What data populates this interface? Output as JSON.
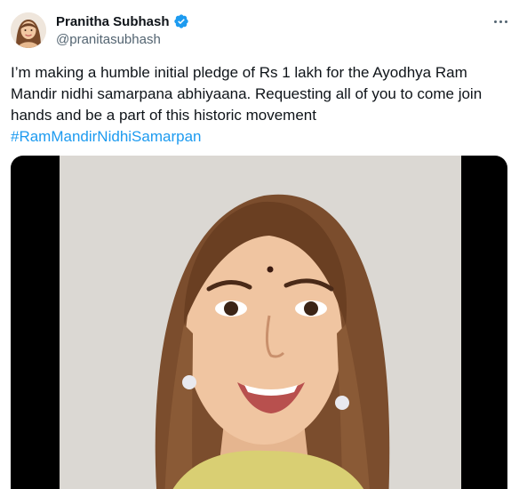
{
  "author": {
    "display_name": "Pranitha Subhash",
    "handle": "@pranitasubhash",
    "verified": true,
    "avatar_icon": "avatar-icon"
  },
  "tweet": {
    "text": "I’m making a humble initial pledge of Rs 1 lakh for the Ayodhya Ram Mandir nidhi samarpana abhiyaana. Requesting all of you to come join hands and be a part of this historic movement",
    "hashtag": "#RamMandirNidhiSamarpan"
  },
  "media": {
    "type": "video"
  },
  "colors": {
    "accent": "#1d9bf0",
    "text_primary": "#0f1419",
    "text_secondary": "#536471",
    "media_letterbox": "#000000"
  }
}
